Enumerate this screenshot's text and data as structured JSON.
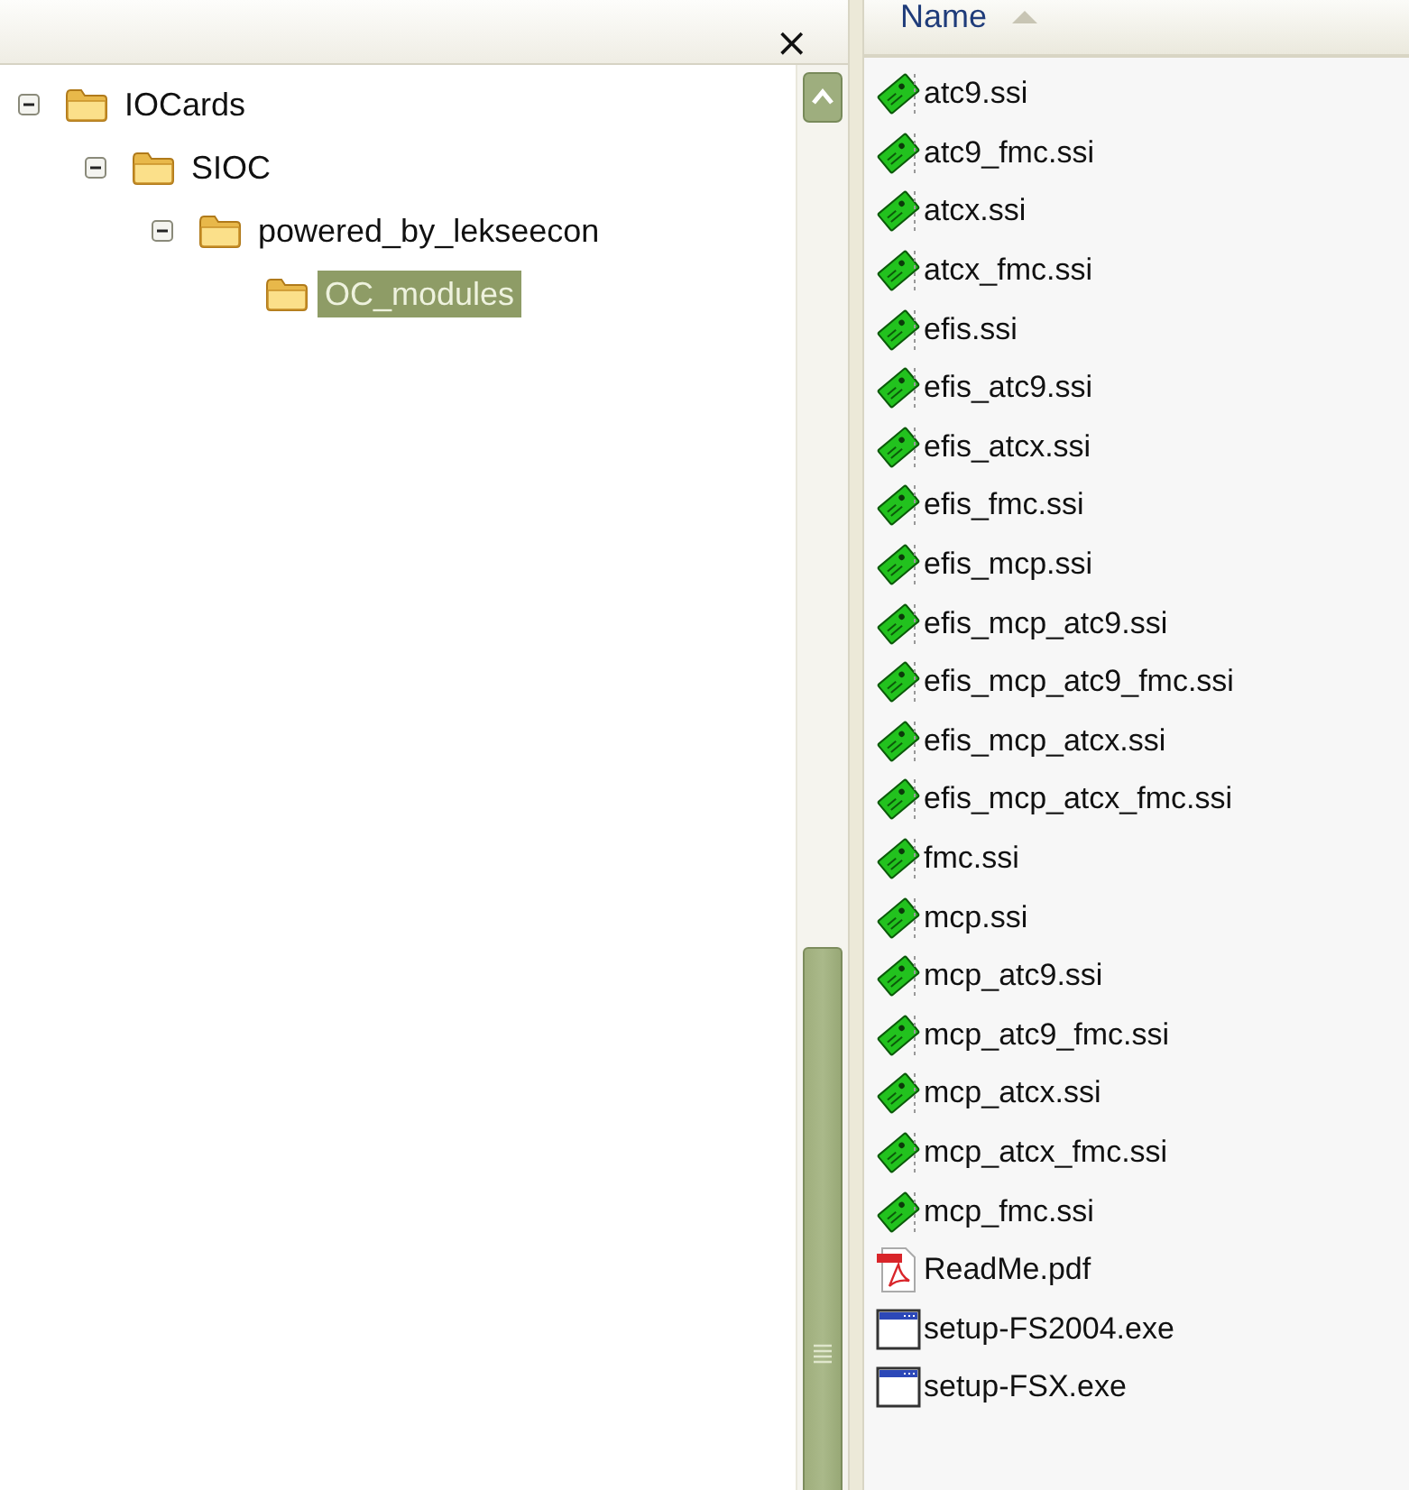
{
  "tree_pane": {
    "close": "×",
    "tree": [
      {
        "label": "IOCards",
        "expanded": true,
        "selected": false,
        "children": [
          {
            "label": "SIOC",
            "expanded": true,
            "selected": false,
            "children": [
              {
                "label": "powered_by_lekseecon",
                "expanded": true,
                "selected": false,
                "children": [
                  {
                    "label": "OC_modules",
                    "selected": true
                  }
                ]
              }
            ]
          }
        ]
      }
    ]
  },
  "file_list": {
    "columns": [
      {
        "label": "Name",
        "sorted_ascending": true
      }
    ],
    "files": [
      {
        "name": "atc9.ssi",
        "kind": "ssi"
      },
      {
        "name": "atc9_fmc.ssi",
        "kind": "ssi"
      },
      {
        "name": "atcx.ssi",
        "kind": "ssi"
      },
      {
        "name": "atcx_fmc.ssi",
        "kind": "ssi"
      },
      {
        "name": "efis.ssi",
        "kind": "ssi"
      },
      {
        "name": "efis_atc9.ssi",
        "kind": "ssi"
      },
      {
        "name": "efis_atcx.ssi",
        "kind": "ssi"
      },
      {
        "name": "efis_fmc.ssi",
        "kind": "ssi"
      },
      {
        "name": "efis_mcp.ssi",
        "kind": "ssi"
      },
      {
        "name": "efis_mcp_atc9.ssi",
        "kind": "ssi"
      },
      {
        "name": "efis_mcp_atc9_fmc.ssi",
        "kind": "ssi"
      },
      {
        "name": "efis_mcp_atcx.ssi",
        "kind": "ssi"
      },
      {
        "name": "efis_mcp_atcx_fmc.ssi",
        "kind": "ssi"
      },
      {
        "name": "fmc.ssi",
        "kind": "ssi"
      },
      {
        "name": "mcp.ssi",
        "kind": "ssi"
      },
      {
        "name": "mcp_atc9.ssi",
        "kind": "ssi"
      },
      {
        "name": "mcp_atc9_fmc.ssi",
        "kind": "ssi"
      },
      {
        "name": "mcp_atcx.ssi",
        "kind": "ssi"
      },
      {
        "name": "mcp_atcx_fmc.ssi",
        "kind": "ssi"
      },
      {
        "name": "mcp_fmc.ssi",
        "kind": "ssi"
      },
      {
        "name": "ReadMe.pdf",
        "kind": "pdf"
      },
      {
        "name": "setup-FS2004.exe",
        "kind": "exe"
      },
      {
        "name": "setup-FSX.exe",
        "kind": "exe"
      }
    ]
  }
}
